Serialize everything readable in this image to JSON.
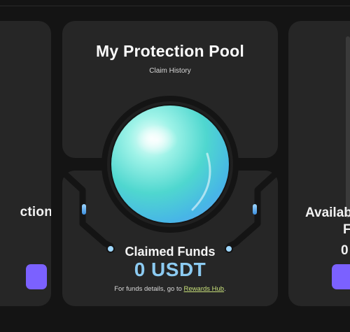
{
  "pool": {
    "title": "My Protection Pool",
    "claim_history": "Claim History",
    "claimed_label": "Claimed Funds",
    "claimed_amount": "0 USDT",
    "details_prefix": "For funds details, go to ",
    "details_link": "Rewards Hub",
    "details_suffix": "."
  },
  "left_card": {
    "text": "ction",
    "button_label": ""
  },
  "right_card": {
    "text_line1": "Availab",
    "text_line2": "F",
    "value": "0"
  },
  "colors": {
    "background": "#141414",
    "card": "#262626",
    "accent_purple": "#7b61ff",
    "amount_blue": "#8ccbf2",
    "link_green": "#c8e07a",
    "orb_teal": "#4fd7cf"
  }
}
